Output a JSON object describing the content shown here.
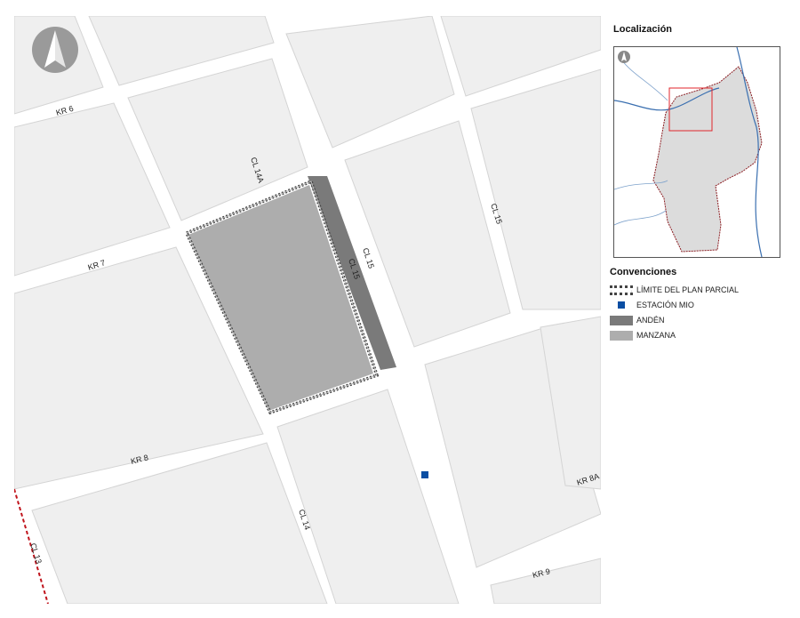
{
  "map": {
    "streets": {
      "kr6": "KR 6",
      "kr7": "KR 7",
      "kr8": "KR 8",
      "kr8a": "KR 8A",
      "kr9": "KR 9",
      "cl14": "CL 14",
      "cl14a": "CL 14A",
      "cl15a": "CL 15",
      "cl15b": "CL 15",
      "cl15c": "CL 15",
      "rail": "CL 13"
    },
    "colors": {
      "block": "#efefef",
      "road": "#ffffff",
      "curb": "#c8c8c8",
      "manzana": "#adadad",
      "anden": "#7a7a7a",
      "limit": "#444444",
      "station": "#0a4ea3",
      "rail": "#c0141c"
    },
    "north_icon": "north-arrow-icon"
  },
  "panel": {
    "location_title": "Localización",
    "legend_title": "Convenciones",
    "legend": [
      {
        "label": "LÍMITE DEL PLAN PARCIAL",
        "symbol": "dashed-outline"
      },
      {
        "label": "ESTACIÓN MIO",
        "symbol": "blue-square"
      },
      {
        "label": "ANDÉN",
        "symbol": "dark-gray-fill"
      },
      {
        "label": "MANZANA",
        "symbol": "light-gray-fill"
      }
    ]
  }
}
